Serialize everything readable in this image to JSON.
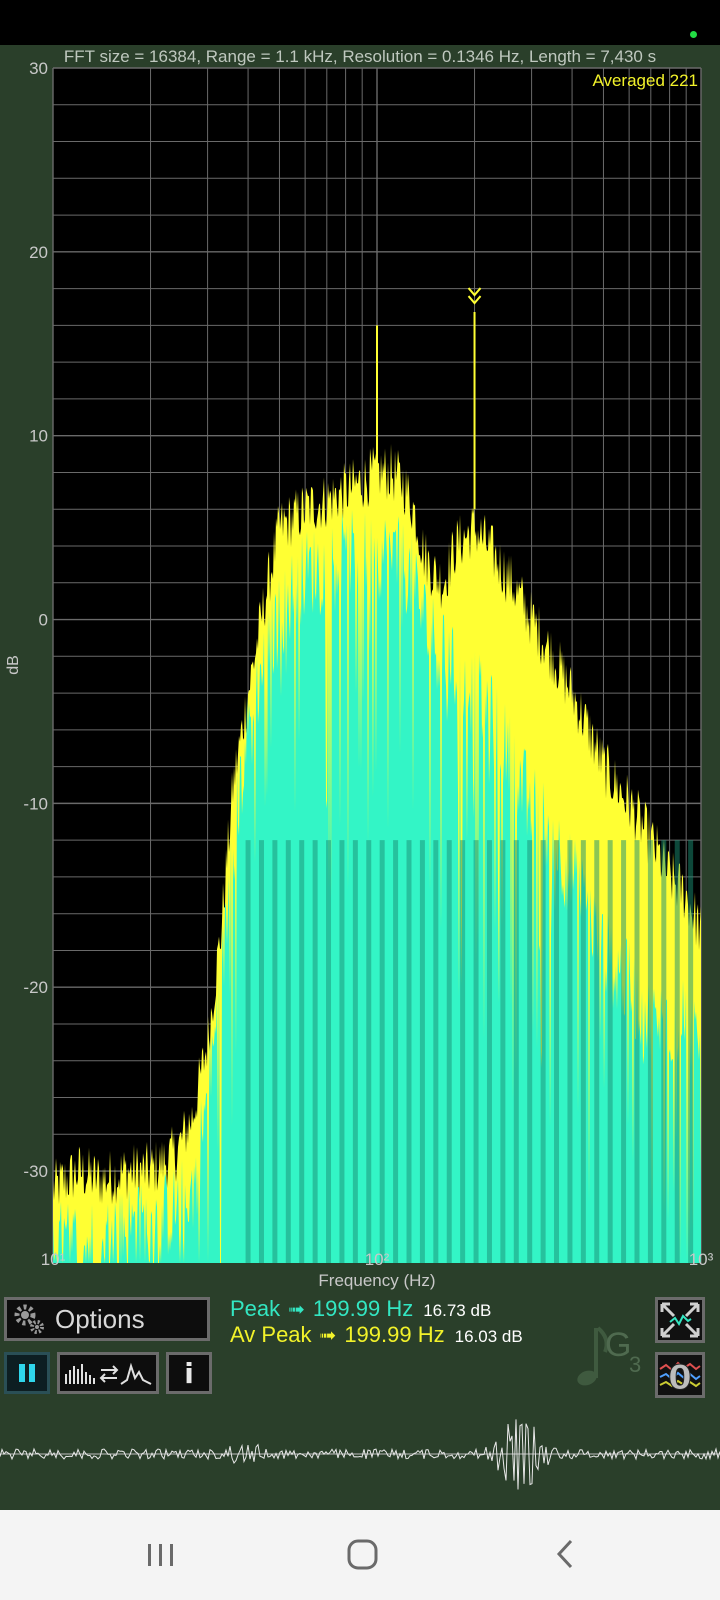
{
  "header": {
    "info": "FFT size = 16384, Range = 1.1 kHz, Resolution = 0.1346 Hz, Length = 7,430 s",
    "averaged": "Averaged 221"
  },
  "chart_data": {
    "type": "line",
    "title": "",
    "xlabel": "Frequency (Hz)",
    "ylabel": "dB",
    "xscale": "log",
    "xlim": [
      10,
      1000
    ],
    "ylim": [
      -35,
      30
    ],
    "x_tick_labels": [
      "10¹",
      "10²",
      "10³"
    ],
    "y_ticks": [
      30,
      20,
      10,
      0,
      -10,
      -20,
      -30
    ],
    "grid": true,
    "series": [
      {
        "color": "#ffff33",
        "x": [
          10,
          12,
          14,
          17,
          20,
          24,
          27,
          30,
          33,
          36,
          40,
          45,
          50,
          55,
          60,
          70,
          80,
          90,
          100,
          110,
          120,
          130,
          140,
          150,
          160,
          175,
          200,
          220,
          250,
          280,
          300,
          350,
          400,
          450,
          500,
          600,
          700,
          800,
          900,
          1000
        ],
        "y": [
          -31,
          -30,
          -30.5,
          -30,
          -30,
          -29,
          -27,
          -23,
          -17,
          -9,
          -4,
          1,
          5,
          5.5,
          6,
          6.5,
          7,
          7.5,
          8,
          8,
          7.5,
          6,
          3.5,
          2.5,
          2,
          4,
          5,
          4,
          2.5,
          1,
          0,
          -2,
          -4,
          -6,
          -8,
          -10,
          -12,
          -14,
          -15,
          -17
        ]
      },
      {
        "color": "#33f5c6",
        "x": [
          10,
          12,
          14,
          17,
          20,
          24,
          27,
          30,
          33,
          36,
          40,
          45,
          50,
          55,
          60,
          70,
          80,
          90,
          100,
          110,
          120,
          130,
          140,
          150,
          160,
          175,
          200,
          220,
          250,
          280,
          300,
          350,
          400,
          450,
          500,
          600,
          700,
          800,
          900,
          1000
        ],
        "y": [
          -34,
          -34,
          -34,
          -33,
          -33,
          -32,
          -31,
          -26,
          -20,
          -12,
          -6,
          -2,
          0,
          1.5,
          2.5,
          3,
          3.5,
          3.5,
          3.5,
          3.5,
          3,
          2,
          0,
          -1,
          -2,
          -3,
          -4,
          -5,
          -7,
          -9,
          -10,
          -12,
          -14,
          -16,
          -18,
          -20,
          -22,
          -22,
          -22,
          -22
        ]
      }
    ],
    "peak_markers": [
      {
        "x": 100,
        "y": 16,
        "color": "#ffff33"
      },
      {
        "x": 199.99,
        "y": 16.73,
        "color": "#ffff33"
      }
    ]
  },
  "readouts": {
    "peak_label": "Peak",
    "peak_arrow": "➟",
    "peak_freq": "199.99 Hz",
    "peak_db": "16.73 dB",
    "avpeak_label": "Av Peak",
    "avpeak_arrow": "➟",
    "avpeak_freq": "199.99 Hz",
    "avpeak_db": "16.03 dB"
  },
  "note": {
    "name": "G",
    "octave": "3"
  },
  "buttons": {
    "options_label": "Options",
    "info_label": "i",
    "zero_label": "0"
  },
  "colors": {
    "yellow_trace": "#ffff33",
    "cyan_trace": "#33f5c6",
    "background": "#2a3f2a",
    "plot_background": "#000000",
    "grid": "#6a6a6a"
  },
  "icons": {
    "options": "gear-icon",
    "pause": "pause-icon",
    "view_toggle": "spectrum-toggle-icon",
    "info": "info-icon",
    "fullscreen": "expand-icon",
    "zero": "zero-reset-icon",
    "note": "music-note-icon",
    "nav_recents": "recents-icon",
    "nav_home": "home-icon",
    "nav_back": "back-icon"
  }
}
